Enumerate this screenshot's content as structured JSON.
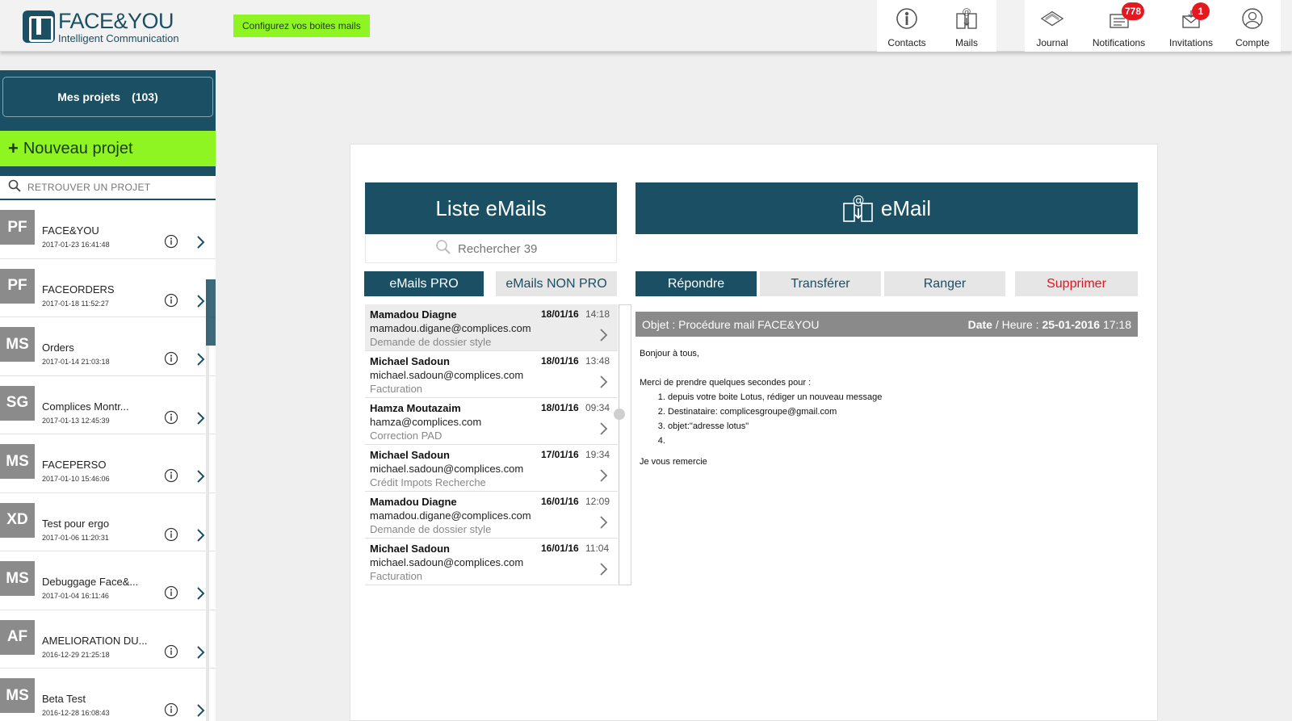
{
  "header": {
    "brand_name": "FACE&YOU",
    "brand_tagline": "Intelligent Communication",
    "config_button": "Configurez vos boites mails",
    "nav": {
      "contacts": {
        "label": "Contacts",
        "icon": "contacts-icon"
      },
      "mails": {
        "label": "Mails",
        "icon": "mails-icon"
      },
      "journal": {
        "label": "Journal",
        "icon": "journal-icon"
      },
      "notifications": {
        "label": "Notifications",
        "icon": "notifications-icon",
        "badge": "778"
      },
      "invitations": {
        "label": "Invitations",
        "icon": "invitations-icon",
        "badge": "1"
      },
      "compte": {
        "label": "Compte",
        "icon": "account-icon"
      }
    }
  },
  "sidebar": {
    "projects_label": "Mes projets",
    "projects_count": "(103)",
    "new_project_label": "Nouveau projet",
    "search_placeholder": "RETROUVER UN PROJET",
    "projects": [
      {
        "initials": "PF",
        "name": "FACE&YOU",
        "date": "2017-01-23 16:41:48"
      },
      {
        "initials": "PF",
        "name": "FACEORDERS",
        "date": "2017-01-18 11:52:27"
      },
      {
        "initials": "MS",
        "name": "Orders",
        "date": "2017-01-14 21:03:18"
      },
      {
        "initials": "SG",
        "name": "Complices Montr...",
        "date": "2017-01-13 12:45:39"
      },
      {
        "initials": "MS",
        "name": "FACEPERSO",
        "date": "2017-01-10 15:46:06"
      },
      {
        "initials": "XD",
        "name": "Test pour ergo",
        "date": "2017-01-06 11:20:31"
      },
      {
        "initials": "MS",
        "name": "Debuggage Face&...",
        "date": "2017-01-04 16:11:46"
      },
      {
        "initials": "AF",
        "name": "AMELIORATION DU...",
        "date": "2016-12-29 21:25:18"
      },
      {
        "initials": "MS",
        "name": "Beta Test",
        "date": "2016-12-28 16:08:43"
      }
    ]
  },
  "email_list": {
    "title": "Liste eMails",
    "search_placeholder": "Rechercher 39",
    "tabs": {
      "pro": "eMails PRO",
      "non_pro": "eMails NON PRO"
    },
    "emails": [
      {
        "sender": "Mamadou Diagne",
        "address": "mamadou.digane@complices.com",
        "subject": "Demande de dossier style",
        "date": "18/01/16",
        "time": "14:18"
      },
      {
        "sender": "Michael Sadoun",
        "address": "michael.sadoun@complices.com",
        "subject": "Facturation",
        "date": "18/01/16",
        "time": "13:48"
      },
      {
        "sender": "Hamza Moutazaim",
        "address": "hamza@complices.com",
        "subject": "Correction PAD",
        "date": "18/01/16",
        "time": "09:34"
      },
      {
        "sender": "Michael Sadoun",
        "address": "michael.sadoun@complices.com",
        "subject": "Crédit Impots Recherche",
        "date": "17/01/16",
        "time": "19:34"
      },
      {
        "sender": "Mamadou Diagne",
        "address": "mamadou.digane@complices.com",
        "subject": "Demande de dossier style",
        "date": "16/01/16",
        "time": "12:09"
      },
      {
        "sender": "Michael Sadoun",
        "address": "michael.sadoun@complices.com",
        "subject": "Facturation",
        "date": "16/01/16",
        "time": "11:04"
      }
    ]
  },
  "email_view": {
    "title": "eMail",
    "actions": {
      "reply": "Répondre",
      "forward": "Transférer",
      "file": "Ranger",
      "delete": "Supprimer"
    },
    "subject_prefix": "Objet :",
    "subject": "Procédure mail FACE&YOU",
    "date_label": "Date",
    "time_label": "/ Heure :",
    "date": "25-01-2016",
    "time": "17:18",
    "body": {
      "greeting": "Bonjour à tous,",
      "intro": "Merci de prendre quelques secondes pour :",
      "steps": [
        "depuis votre boite  Lotus, rédiger un nouveau message",
        "Destinataire: complicesgroupe@gmail.com",
        "objet:\"adresse lotus\"",
        ""
      ],
      "closing": "Je vous remercie"
    }
  },
  "colors": {
    "primary": "#1b4f63",
    "accent_green": "#8ef523",
    "badge_red": "#e5171f",
    "delete_red": "#e0161e"
  }
}
